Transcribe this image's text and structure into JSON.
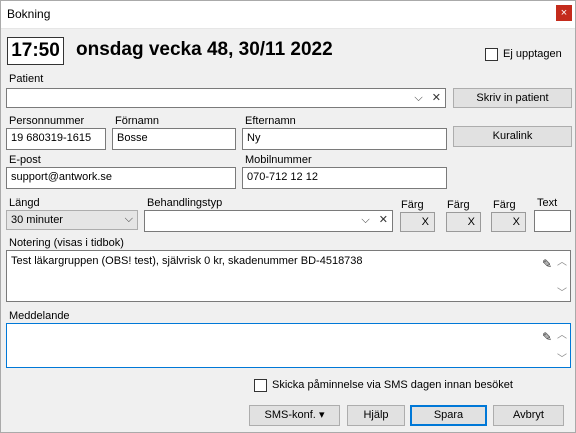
{
  "window": {
    "title": "Bokning",
    "close": "×"
  },
  "header": {
    "time": "17:50",
    "date": "onsdag vecka 48, 30/11 2022",
    "ej_upptagen": "Ej upptagen"
  },
  "patient": {
    "label": "Patient",
    "value": "",
    "write_button": "Skriv in patient"
  },
  "personnummer": {
    "label": "Personnummer",
    "value": "19 680319-1615"
  },
  "fornamn": {
    "label": "Förnamn",
    "value": "Bosse"
  },
  "efternamn": {
    "label": "Efternamn",
    "value": "Ny"
  },
  "kuralink": "Kuralink",
  "epost": {
    "label": "E-post",
    "value": "support@antwork.se"
  },
  "mobil": {
    "label": "Mobilnummer",
    "value": "070-712 12 12"
  },
  "langd": {
    "label": "Längd",
    "value": "30 minuter"
  },
  "behandlingstyp": {
    "label": "Behandlingstyp",
    "value": ""
  },
  "farg": [
    {
      "label": "Färg",
      "value": "X"
    },
    {
      "label": "Färg",
      "value": "X"
    },
    {
      "label": "Färg",
      "value": "X"
    }
  ],
  "text_field": {
    "label": "Text",
    "value": ""
  },
  "notering": {
    "label": "Notering (visas i tidbok)",
    "value": "Test läkargruppen (OBS! test), självrisk 0 kr, skadenummer BD-4518738"
  },
  "meddelande": {
    "label": "Meddelande",
    "value": ""
  },
  "sms_reminder": "Skicka påminnelse via SMS dagen innan besöket",
  "buttons": {
    "sms_conf": "SMS-konf.",
    "sms_arrow": "▾",
    "help": "Hjälp",
    "save": "Spara",
    "cancel": "Avbryt"
  },
  "icons": {
    "chevron": "⌵",
    "clear": "✕",
    "pencil": "✎",
    "scroll_up": "︿",
    "scroll_down": "﹀"
  }
}
